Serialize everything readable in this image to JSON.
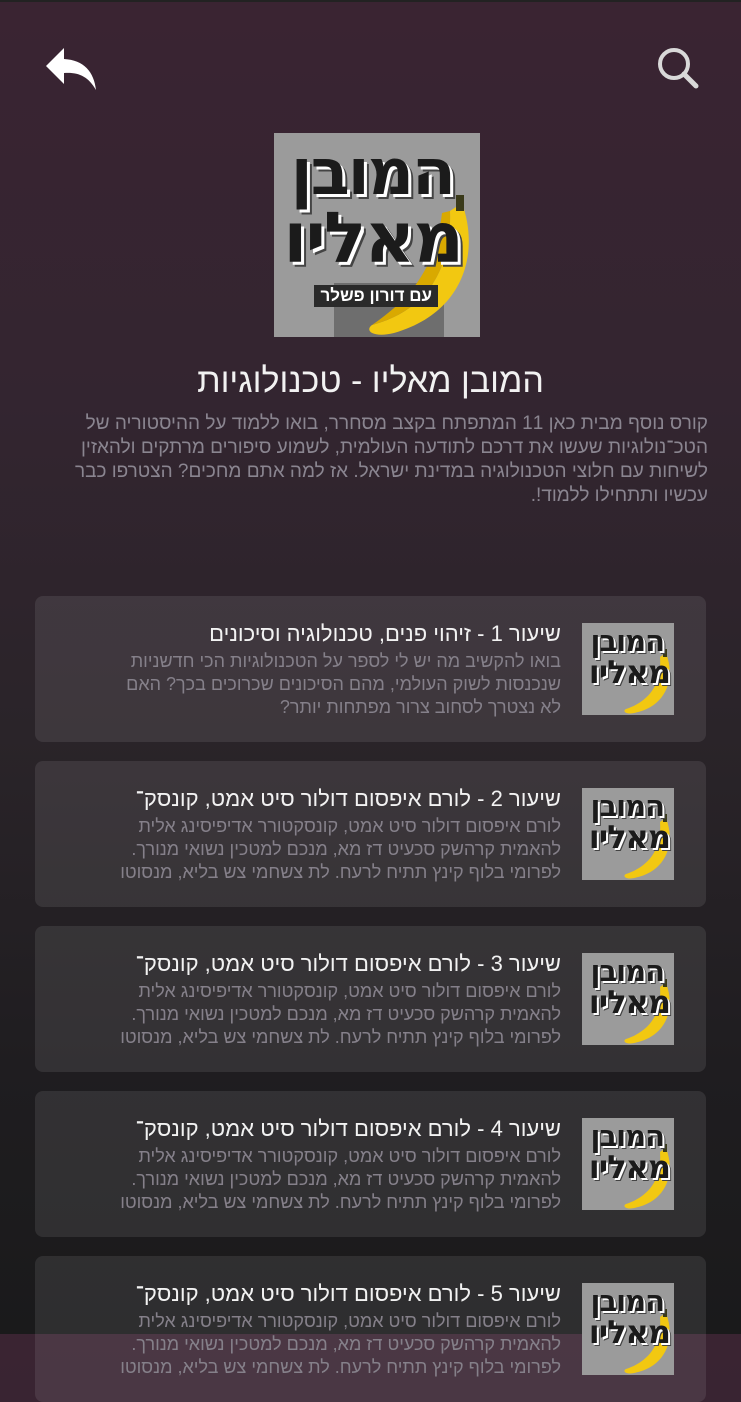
{
  "header": {
    "back_icon": "back-arrow-icon",
    "search_icon": "search-icon"
  },
  "cover": {
    "line1": "המובן",
    "line2": "מאליו",
    "subtitle": "עם דורון פשלר",
    "banana_color": "#f2c811"
  },
  "course": {
    "title": "המובן מאליו - טכנולוגיות",
    "description": "קורס נוסף מבית כאן 11 המתפתח בקצב מסחרר, בואו ללמוד על ההיסטוריה של הטכ־נולוגיות שעשו את דרכם לתודעה העולמית, לשמוע סיפורים מרתקים ולהאזין לשיחות עם חלוצי הטכנולוגיה במדינת ישראל. אז למה אתם מחכים? הצטרפו כבר עכשיו ותתחילו ללמוד!."
  },
  "lessons": [
    {
      "title": "שיעור 1 - זיהוי פנים, טכנולוגיה וסיכונים",
      "description": "בואו להקשיב מה יש לי לספר על הטכנולוגיות הכי חדשניות שנכנסות לשוק העולמי, מהם הסיכונים שכרוכים בכך? האם לא נצטרך לסחוב צרור מפתחות יותר?"
    },
    {
      "title": "שיעור 2 - לורם איפסום דולור סיט אמט, קונסק־",
      "description": "לורם איפסום דולור סיט אמט, קונסקטורר אדיפיסינג אלית להאמית קרהשק סכעיט דז מא, מנכם למטכין נשואי מנורך. לפרומי בלוף קינץ תתיח לרעח. לת צשחמי צש בליא, מנסוטו"
    },
    {
      "title": "שיעור 3 - לורם איפסום דולור סיט אמט, קונסק־",
      "description": "לורם איפסום דולור סיט אמט, קונסקטורר אדיפיסינג אלית להאמית קרהשק סכעיט דז מא, מנכם למטכין נשואי מנורך. לפרומי בלוף קינץ תתיח לרעח. לת צשחמי צש בליא, מנסוטו"
    },
    {
      "title": "שיעור 4 - לורם איפסום דולור סיט אמט, קונסק־",
      "description": "לורם איפסום דולור סיט אמט, קונסקטורר אדיפיסינג אלית להאמית קרהשק סכעיט דז מא, מנכם למטכין נשואי מנורך. לפרומי בלוף קינץ תתיח לרעח. לת צשחמי צש בליא, מנסוטו"
    },
    {
      "title": "שיעור 5 - לורם איפסום דולור סיט אמט, קונסק־",
      "description": "לורם איפסום דולור סיט אמט, קונסקטורר אדיפיסינג אלית להאמית קרהשק סכעיט דז מא, מנכם למטכין נשואי מנורך. לפרומי בלוף קינץ תתיח לרעח. לת צשחמי צש בליא, מנסוטו"
    }
  ]
}
